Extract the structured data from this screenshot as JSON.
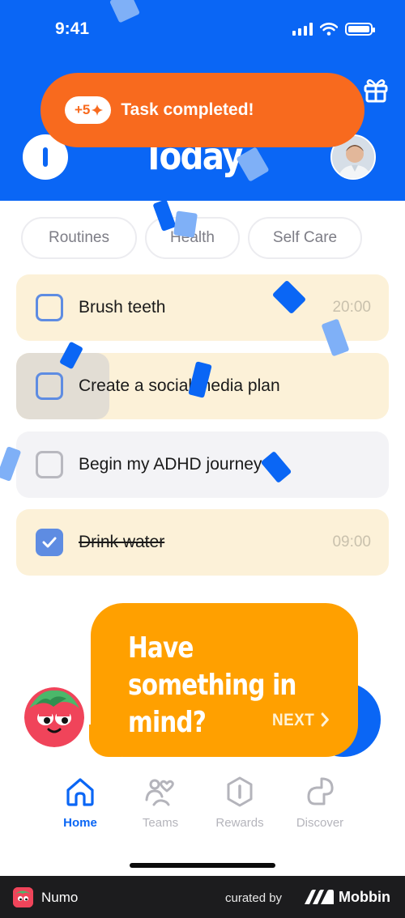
{
  "status_bar": {
    "time": "9:41"
  },
  "header": {
    "title": "Today"
  },
  "toast": {
    "badge": "+5",
    "message": "Task completed!"
  },
  "chips": [
    {
      "label": "Routines"
    },
    {
      "label": "Health"
    },
    {
      "label": "Self Care"
    }
  ],
  "tasks": [
    {
      "label": "Brush teeth",
      "time": "20:00",
      "done": false
    },
    {
      "label": "Create a social media plan",
      "time": "",
      "done": false
    },
    {
      "label": "Begin my ADHD journey",
      "time": "",
      "done": false
    },
    {
      "label": "Drink water",
      "time": "09:00",
      "done": true
    }
  ],
  "prompt": {
    "title": "Have something in mind?",
    "next_label": "NEXT"
  },
  "nav": [
    {
      "label": "Home",
      "active": true
    },
    {
      "label": "Teams",
      "active": false
    },
    {
      "label": "Rewards",
      "active": false
    },
    {
      "label": "Discover",
      "active": false
    }
  ],
  "footer": {
    "app_name": "Numo",
    "curated_by": "curated by",
    "brand": "Mobbin"
  },
  "colors": {
    "primary_blue": "#0a66f5",
    "toast_orange": "#f86a1e",
    "bubble_orange": "#ffa000",
    "task_cream": "#fcf1d8",
    "task_grey": "#f3f3f6"
  }
}
